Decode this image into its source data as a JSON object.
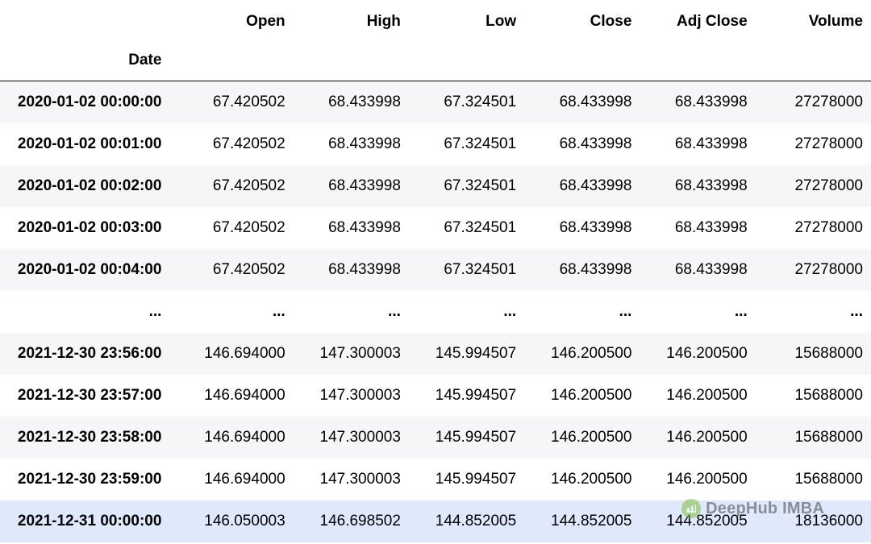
{
  "chart_data": {
    "type": "table",
    "index_name": "Date",
    "columns": [
      "Open",
      "High",
      "Low",
      "Close",
      "Adj Close",
      "Volume"
    ],
    "rows": [
      {
        "index": "2020-01-02 00:00:00",
        "open": "67.420502",
        "high": "68.433998",
        "low": "67.324501",
        "close": "68.433998",
        "adj_close": "68.433998",
        "volume": "27278000"
      },
      {
        "index": "2020-01-02 00:01:00",
        "open": "67.420502",
        "high": "68.433998",
        "low": "67.324501",
        "close": "68.433998",
        "adj_close": "68.433998",
        "volume": "27278000"
      },
      {
        "index": "2020-01-02 00:02:00",
        "open": "67.420502",
        "high": "68.433998",
        "low": "67.324501",
        "close": "68.433998",
        "adj_close": "68.433998",
        "volume": "27278000"
      },
      {
        "index": "2020-01-02 00:03:00",
        "open": "67.420502",
        "high": "68.433998",
        "low": "67.324501",
        "close": "68.433998",
        "adj_close": "68.433998",
        "volume": "27278000"
      },
      {
        "index": "2020-01-02 00:04:00",
        "open": "67.420502",
        "high": "68.433998",
        "low": "67.324501",
        "close": "68.433998",
        "adj_close": "68.433998",
        "volume": "27278000"
      },
      {
        "index": "...",
        "open": "...",
        "high": "...",
        "low": "...",
        "close": "...",
        "adj_close": "...",
        "volume": "...",
        "ellipsis": true
      },
      {
        "index": "2021-12-30 23:56:00",
        "open": "146.694000",
        "high": "147.300003",
        "low": "145.994507",
        "close": "146.200500",
        "adj_close": "146.200500",
        "volume": "15688000"
      },
      {
        "index": "2021-12-30 23:57:00",
        "open": "146.694000",
        "high": "147.300003",
        "low": "145.994507",
        "close": "146.200500",
        "adj_close": "146.200500",
        "volume": "15688000"
      },
      {
        "index": "2021-12-30 23:58:00",
        "open": "146.694000",
        "high": "147.300003",
        "low": "145.994507",
        "close": "146.200500",
        "adj_close": "146.200500",
        "volume": "15688000"
      },
      {
        "index": "2021-12-30 23:59:00",
        "open": "146.694000",
        "high": "147.300003",
        "low": "145.994507",
        "close": "146.200500",
        "adj_close": "146.200500",
        "volume": "15688000"
      },
      {
        "index": "2021-12-31 00:00:00",
        "open": "146.050003",
        "high": "146.698502",
        "low": "144.852005",
        "close": "144.852005",
        "adj_close": "144.852005",
        "volume": "18136000",
        "highlight": true
      }
    ]
  },
  "watermark": {
    "text": "DeepHub IMBA"
  }
}
